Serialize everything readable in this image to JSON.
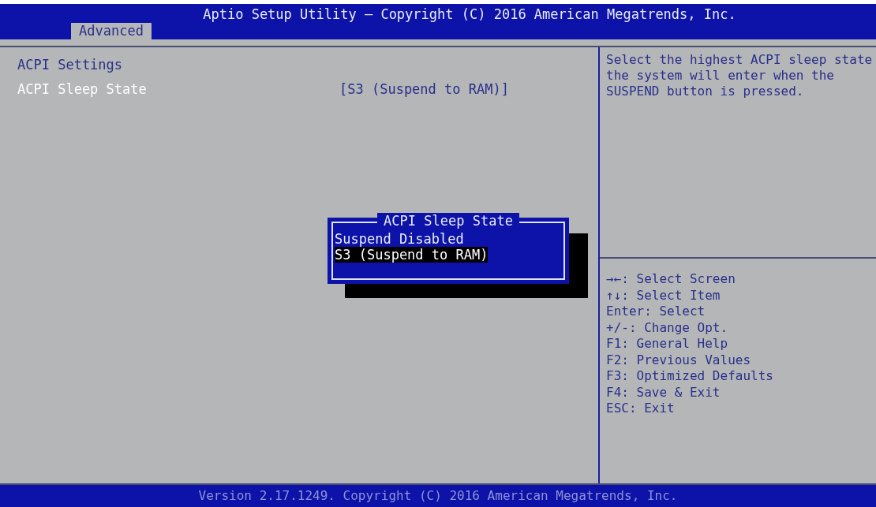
{
  "header": {
    "title": "Aptio Setup Utility – Copyright (C) 2016 American Megatrends, Inc.",
    "tabs": [
      {
        "label": "Advanced",
        "selected": true
      }
    ]
  },
  "settings": [
    {
      "kind": "heading",
      "label": "ACPI Settings",
      "selected": false
    },
    {
      "kind": "option",
      "label": "ACPI Sleep State",
      "value": "[S3 (Suspend to RAM)]",
      "selected": true
    }
  ],
  "popup": {
    "title": "ACPI Sleep State",
    "options": [
      {
        "label": "Suspend Disabled",
        "selected": false
      },
      {
        "label": "S3 (Suspend to RAM)",
        "selected": true
      }
    ]
  },
  "help": {
    "text": "Select the highest ACPI sleep state the system will enter when the SUSPEND button is pressed.",
    "keys": [
      "→←: Select Screen",
      "↑↓: Select Item",
      "Enter: Select",
      "+/-: Change Opt.",
      "F1: General Help",
      "F2: Previous Values",
      "F3: Optimized Defaults",
      "F4: Save & Exit",
      "ESC: Exit"
    ]
  },
  "footer": "Version 2.17.1249. Copyright (C) 2016 American Megatrends, Inc."
}
